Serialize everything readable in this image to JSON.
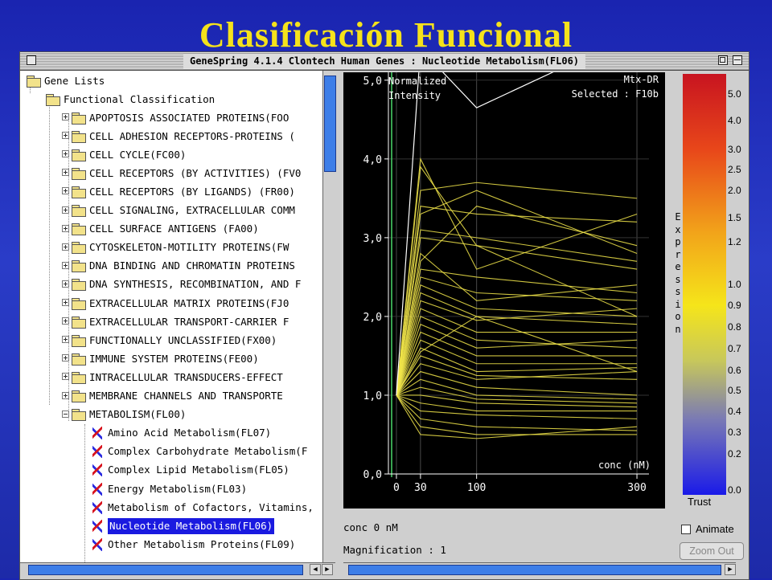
{
  "slide": {
    "title": "Clasificación Funcional"
  },
  "window": {
    "title": "GeneSpring 4.1.4  Clontech Human  Genes : Nucleotide Metabolism(FL06)"
  },
  "tree": {
    "root": "Gene Lists",
    "category": "Functional Classification",
    "folders": [
      "APOPTOSIS ASSOCIATED PROTEINS(FOO",
      "CELL ADHESION RECEPTORS-PROTEINS (",
      "CELL CYCLE(FC00)",
      "CELL RECEPTORS (BY ACTIVITIES) (FV0",
      "CELL RECEPTORS (BY LIGANDS) (FR00)",
      "CELL SIGNALING, EXTRACELLULAR COMM",
      "CELL SURFACE ANTIGENS (FA00)",
      "CYTOSKELETON-MOTILITY PROTEINS(FW",
      "DNA BINDING AND CHROMATIN PROTEINS",
      "DNA SYNTHESIS, RECOMBINATION, AND F",
      "EXTRACELLULAR MATRIX PROTEINS(FJ0",
      "EXTRACELLULAR TRANSPORT-CARRIER F",
      "FUNCTIONALLY UNCLASSIFIED(FX00)",
      "IMMUNE SYSTEM PROTEINS(FE00)",
      "INTRACELLULAR TRANSDUCERS-EFFECT",
      "MEMBRANE CHANNELS AND TRANSPORTE",
      "METABOLISM(FL00)"
    ],
    "genelists": [
      "Amino Acid Metabolism(FL07)",
      "Complex Carbohydrate Metabolism(F",
      "Complex Lipid Metabolism(FL05)",
      "Energy Metabolism(FL03)",
      "Metabolism of Cofactors, Vitamins,",
      "Nucleotide Metabolism(FL06)",
      "Other Metabolism Proteins(FL09)"
    ],
    "selected_index": 5
  },
  "plot": {
    "ylabel_line1": "Normalized",
    "ylabel_line2": "Intensity",
    "info_line1": "Mtx-DR",
    "info_line2": "Selected : F10b",
    "xlabel": "conc (nM)"
  },
  "chart_data": {
    "type": "line",
    "xlabel": "conc (nM)",
    "ylabel": "Normalized Intensity",
    "x": [
      0,
      30,
      100,
      300
    ],
    "x_ticks": [
      "0",
      "30",
      "100",
      "300"
    ],
    "y_ticks": [
      "0,0",
      "1,0",
      "2,0",
      "3,0",
      "4,0",
      "5,0"
    ],
    "ylim": [
      0,
      5.1
    ],
    "xlim": [
      -10,
      315
    ],
    "grid": true,
    "highlight_color": "#ffffff",
    "line_color": "#f2e64a",
    "highlight_series": [
      1,
      5.4,
      4.65,
      5.6
    ],
    "series": [
      [
        1,
        3.6,
        3.7,
        3.5
      ],
      [
        1,
        3.4,
        3.3,
        3.2
      ],
      [
        1,
        3.3,
        3.6,
        2.8
      ],
      [
        1,
        3.1,
        3.0,
        2.7
      ],
      [
        1,
        3.0,
        2.9,
        2.6
      ],
      [
        1,
        2.8,
        2.2,
        2.4
      ],
      [
        1,
        2.6,
        2.5,
        2.3
      ],
      [
        1,
        2.5,
        2.3,
        2.2
      ],
      [
        1,
        2.4,
        2.1,
        2.0
      ],
      [
        1,
        2.3,
        2.0,
        1.9
      ],
      [
        1,
        2.2,
        1.95,
        2.1
      ],
      [
        1,
        2.1,
        1.8,
        1.8
      ],
      [
        1,
        2.0,
        1.7,
        1.6
      ],
      [
        1,
        1.9,
        1.6,
        1.7
      ],
      [
        1,
        1.8,
        1.5,
        1.5
      ],
      [
        1,
        1.7,
        1.4,
        1.4
      ],
      [
        1,
        1.6,
        1.3,
        1.35
      ],
      [
        1,
        1.5,
        1.25,
        1.2
      ],
      [
        1,
        1.4,
        1.2,
        1.3
      ],
      [
        1,
        1.3,
        1.1,
        1.0
      ],
      [
        1,
        1.2,
        1.0,
        0.95
      ],
      [
        1,
        1.1,
        0.95,
        0.9
      ],
      [
        1,
        1.0,
        0.9,
        0.85
      ],
      [
        1,
        0.9,
        0.8,
        0.8
      ],
      [
        1,
        0.8,
        0.75,
        0.7
      ],
      [
        1,
        0.7,
        0.6,
        0.55
      ],
      [
        1,
        0.6,
        0.5,
        0.5
      ],
      [
        1,
        0.5,
        0.45,
        0.6
      ],
      [
        1,
        4.0,
        2.6,
        3.3
      ],
      [
        1,
        3.9,
        2.9,
        2.0
      ],
      [
        1,
        2.7,
        3.4,
        2.9
      ],
      [
        1,
        1.55,
        2.0,
        1.3
      ]
    ]
  },
  "colorbar": {
    "label_letters": [
      "E",
      "x",
      "p",
      "r",
      "e",
      "s",
      "s",
      "i",
      "o",
      "n"
    ],
    "ticks": [
      "5.0",
      "4.0",
      "3.0",
      "2.5",
      "2.0",
      "1.5",
      "1.2",
      "1.0",
      "0.9",
      "0.8",
      "0.7",
      "0.6",
      "0.5",
      "0.4",
      "0.3",
      "0.2",
      "0.0"
    ],
    "trust_label": "Trust"
  },
  "status": {
    "conc": "conc 0 nM",
    "magnification": "Magnification : 1"
  },
  "controls": {
    "animate_label": "Animate",
    "zoom_out_label": "Zoom Out"
  },
  "icons": {
    "scroll_up": "▲",
    "scroll_down": "▼",
    "scroll_left": "◀",
    "scroll_right": "▶"
  }
}
